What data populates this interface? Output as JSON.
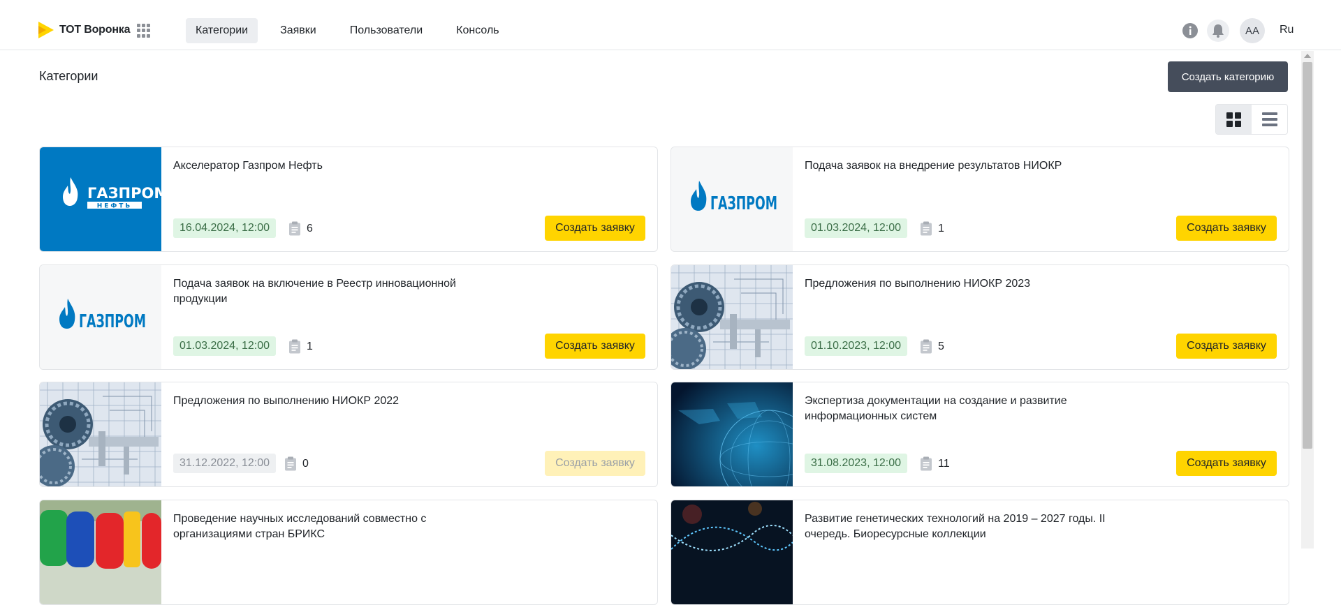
{
  "app": {
    "logo_text": "ТОТ Воронка"
  },
  "nav": [
    "Категории",
    "Заявки",
    "Пользователи",
    "Консоль"
  ],
  "header_right": {
    "avatar": "АА",
    "lang": "Ru"
  },
  "page": {
    "title": "Категории",
    "create_button": "Создать категорию"
  },
  "cards": [
    {
      "title": "Акселератор Газпром Нефть",
      "date": "16.04.2024, 12:00",
      "count": "6",
      "button": "Создать заявку",
      "active": true,
      "image": "gazprom-neft-logo"
    },
    {
      "title": "Подача заявок на внедрение результатов НИОКР",
      "date": "01.03.2024, 12:00",
      "count": "1",
      "button": "Создать заявку",
      "active": true,
      "image": "gazprom-logo"
    },
    {
      "title": "Подача заявок на включение в Реестр инновационной продукции",
      "date": "01.03.2024, 12:00",
      "count": "1",
      "button": "Создать заявку",
      "active": true,
      "image": "gazprom-logo"
    },
    {
      "title": "Предложения по выполнению НИОКР 2023",
      "date": "01.10.2023, 12:00",
      "count": "5",
      "button": "Создать заявку",
      "active": true,
      "image": "gears-blueprint"
    },
    {
      "title": "Предложения по выполнению НИОКР 2022",
      "date": "31.12.2022, 12:00",
      "count": "0",
      "button": "Создать заявку",
      "active": false,
      "image": "gears-blueprint"
    },
    {
      "title": "Экспертиза документации на создание и развитие информационных систем",
      "date": "31.08.2023, 12:00",
      "count": "11",
      "button": "Создать заявку",
      "active": true,
      "image": "digital-globe"
    },
    {
      "title": "Проведение научных исследований совместно с организациями стран БРИКС",
      "image": "brics-letters"
    },
    {
      "title": "Развитие генетических технологий на 2019 – 2027 годы. II очередь. Биоресурсные коллекции",
      "image": "dna-helix"
    }
  ],
  "gazprom_neft_logo": {
    "line1": "ГАЗПРОМ",
    "line2": "НЕФТЬ"
  },
  "gazprom_logo": {
    "word": "ГАЗПРОМ"
  },
  "colors": {
    "accent": "#ffd400",
    "dark_button": "#454d5b",
    "date_green_bg": "#dff5e4",
    "gazprom_blue": "#0079c2"
  }
}
